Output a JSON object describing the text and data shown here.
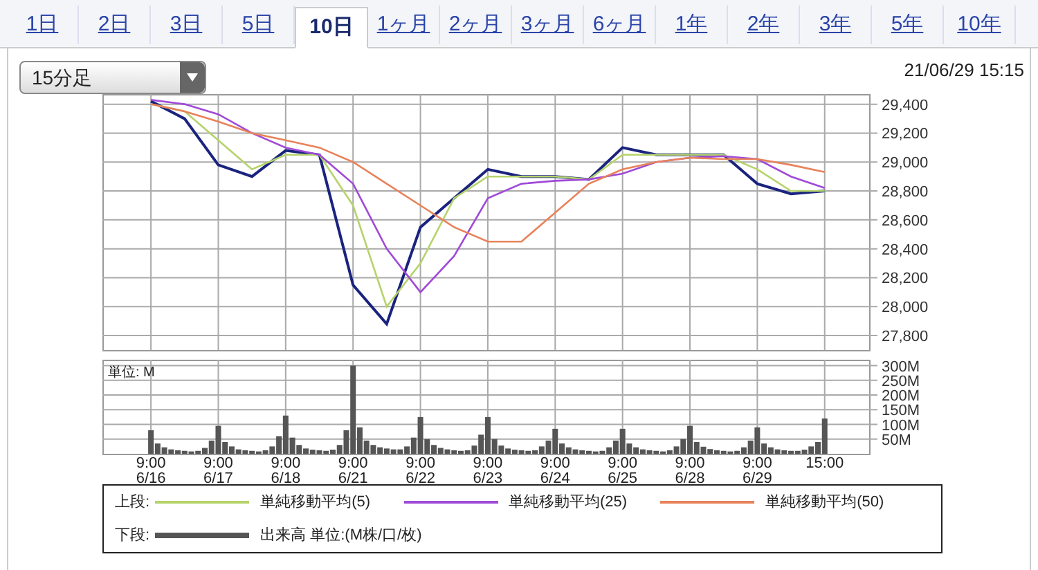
{
  "tabs": [
    {
      "label": "1日",
      "selected": false
    },
    {
      "label": "2日",
      "selected": false
    },
    {
      "label": "3日",
      "selected": false
    },
    {
      "label": "5日",
      "selected": false
    },
    {
      "label": "10日",
      "selected": true
    },
    {
      "label": "1ヶ月",
      "selected": false
    },
    {
      "label": "2ヶ月",
      "selected": false
    },
    {
      "label": "3ヶ月",
      "selected": false
    },
    {
      "label": "6ヶ月",
      "selected": false
    },
    {
      "label": "1年",
      "selected": false
    },
    {
      "label": "2年",
      "selected": false
    },
    {
      "label": "3年",
      "selected": false
    },
    {
      "label": "5年",
      "selected": false
    },
    {
      "label": "10年",
      "selected": false
    }
  ],
  "interval_select": {
    "value": "15分足"
  },
  "timestamp": "21/06/29 15:15",
  "price_chart": {
    "chart_data": {
      "type": "line",
      "grid": true,
      "ylim": [
        27700,
        29470
      ],
      "yticks": [
        {
          "value": 27800,
          "label": "27,800"
        },
        {
          "value": 28000,
          "label": "28,000"
        },
        {
          "value": 28200,
          "label": "28,200"
        },
        {
          "value": 28400,
          "label": "28,400"
        },
        {
          "value": 28600,
          "label": "28,600"
        },
        {
          "value": 28800,
          "label": "28,800"
        },
        {
          "value": 29000,
          "label": "29,000"
        },
        {
          "value": 29200,
          "label": "29,200"
        },
        {
          "value": 29400,
          "label": "29,400"
        }
      ],
      "categories": [
        null,
        null,
        null,
        null,
        null,
        null,
        null,
        null,
        null,
        null,
        null,
        null,
        null,
        null,
        null,
        null,
        null,
        null,
        null,
        null,
        null
      ],
      "series": [
        {
          "color": "#1a237e",
          "values": [
            29420,
            29300,
            28980,
            28900,
            29080,
            29050,
            28150,
            27880,
            28550,
            28750,
            28950,
            28900,
            28900,
            28880,
            29100,
            29050,
            29050,
            29050,
            28850,
            28780,
            28800
          ]
        },
        {
          "name": "単純移動平均(5)",
          "color": "#b5d36b",
          "values": [
            29400,
            29350,
            29150,
            28950,
            29050,
            29050,
            28700,
            28000,
            28300,
            28750,
            28900,
            28900,
            28900,
            28880,
            29050,
            29050,
            29050,
            29050,
            28950,
            28800,
            28800
          ]
        },
        {
          "name": "単純移動平均(25)",
          "color": "#a04ad8",
          "values": [
            29430,
            29400,
            29330,
            29200,
            29100,
            29050,
            28850,
            28400,
            28100,
            28350,
            28750,
            28850,
            28870,
            28880,
            28920,
            29000,
            29030,
            29040,
            29020,
            28900,
            28820
          ]
        },
        {
          "name": "単純移動平均(50)",
          "color": "#e8825a",
          "values": [
            29400,
            29350,
            29280,
            29200,
            29150,
            29100,
            29000,
            28850,
            28700,
            28550,
            28450,
            28450,
            28650,
            28850,
            28950,
            29000,
            29030,
            29020,
            29020,
            28980,
            28930
          ]
        }
      ]
    }
  },
  "volume_chart": {
    "unit_label": "単位: M",
    "chart_data": {
      "type": "bar",
      "grid": true,
      "ylim": [
        0,
        320
      ],
      "yticks": [
        {
          "value": 50,
          "label": "50M"
        },
        {
          "value": 100,
          "label": "100M"
        },
        {
          "value": 150,
          "label": "150M"
        },
        {
          "value": 200,
          "label": "200M"
        },
        {
          "value": 250,
          "label": "250M"
        },
        {
          "value": 300,
          "label": "300M"
        }
      ],
      "categories": [
        "9:00",
        null,
        null,
        null,
        null,
        null,
        null,
        null,
        null,
        null,
        "9:00",
        null,
        null,
        null,
        null,
        null,
        null,
        null,
        null,
        null,
        "9:00",
        null,
        null,
        null,
        null,
        null,
        null,
        null,
        null,
        null,
        "9:00",
        null,
        null,
        null,
        null,
        null,
        null,
        null,
        null,
        null,
        "9:00",
        null,
        null,
        null,
        null,
        null,
        null,
        null,
        null,
        null,
        "9:00",
        null,
        null,
        null,
        null,
        null,
        null,
        null,
        null,
        null,
        "9:00",
        null,
        null,
        null,
        null,
        null,
        null,
        null,
        null,
        null,
        "9:00",
        null,
        null,
        null,
        null,
        null,
        null,
        null,
        null,
        null,
        "9:00",
        null,
        null,
        null,
        null,
        null,
        null,
        null,
        null,
        null,
        "9:00",
        null,
        null,
        null,
        null,
        null,
        null,
        null,
        null,
        null,
        "15:00"
      ],
      "series": [
        {
          "name": "出来高 単位:(M株/口/枚)",
          "color": "#555555",
          "values": [
            80,
            35,
            22,
            15,
            12,
            10,
            8,
            10,
            20,
            45,
            95,
            40,
            25,
            15,
            12,
            10,
            8,
            12,
            25,
            60,
            130,
            55,
            30,
            18,
            14,
            12,
            10,
            14,
            30,
            80,
            300,
            90,
            45,
            30,
            22,
            18,
            15,
            15,
            25,
            55,
            125,
            50,
            30,
            20,
            15,
            12,
            10,
            12,
            28,
            65,
            125,
            50,
            28,
            18,
            14,
            12,
            10,
            12,
            25,
            45,
            85,
            35,
            22,
            15,
            12,
            10,
            8,
            10,
            22,
            45,
            85,
            35,
            22,
            15,
            12,
            10,
            8,
            12,
            25,
            50,
            95,
            40,
            24,
            16,
            12,
            10,
            8,
            10,
            22,
            45,
            90,
            35,
            22,
            15,
            12,
            10,
            10,
            14,
            25,
            40,
            120
          ]
        }
      ]
    },
    "date_labels": [
      "6/16",
      "6/17",
      "6/18",
      "6/21",
      "6/22",
      "6/23",
      "6/24",
      "6/25",
      "6/28",
      "6/29"
    ]
  },
  "legend": {
    "upper_label": "上段:",
    "lower_label": "下段:"
  }
}
